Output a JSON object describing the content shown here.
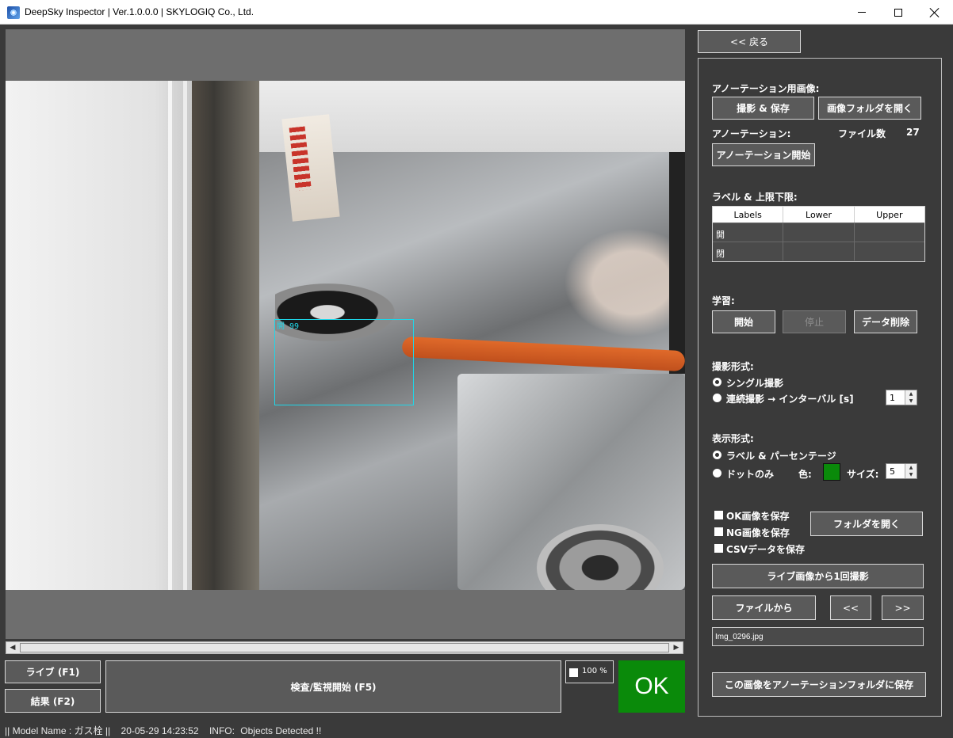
{
  "window": {
    "title": "DeepSky Inspector | Ver.1.0.0.0 | SKYLOGIQ Co., Ltd."
  },
  "viewer": {
    "detection_label": "開 99"
  },
  "bottom": {
    "live_button": "ライブ (F1)",
    "result_button": "結果 (F2)",
    "inspect_button": "検査/監視開始 (F5)",
    "percent_label": "100 %",
    "verdict": "OK",
    "verdict_color": "#0a8a0a"
  },
  "status": {
    "model": "|| Model Name : ガス栓 ||",
    "datetime": "20-05-29 14:23:52",
    "info_key": "INFO:",
    "info_value": "Objects Detected !!"
  },
  "panel": {
    "back_button": "<< 戻る",
    "annot_images_label": "アノーテーション用画像:",
    "capture_save_button": "撮影 & 保存",
    "open_image_folder_button": "画像フォルダを開く",
    "annotation_label": "アノーテーション:",
    "file_count_label": "ファイル数",
    "file_count": "27",
    "start_annotation_button": "アノーテーション開始",
    "labels_limits_label": "ラベル & 上限下限:",
    "table": {
      "headers": [
        "Labels",
        "Lower",
        "Upper"
      ],
      "rows": [
        [
          "開",
          "",
          ""
        ],
        [
          "閉",
          "",
          ""
        ]
      ]
    },
    "learning_label": "学習:",
    "start_button": "開始",
    "stop_button": "停止",
    "delete_data_button": "データ削除",
    "capture_mode_label": "撮影形式:",
    "single_capture": "シングル撮影",
    "continuous_capture": "連続撮影 → インターバル [s]",
    "interval_value": "1",
    "display_mode_label": "表示形式:",
    "label_percentage": "ラベル & パーセンテージ",
    "dot_only": "ドットのみ",
    "color_label": "色:",
    "size_label": "サイズ:",
    "size_value": "5",
    "save_ok": "OK画像を保存",
    "save_ng": "NG画像を保存",
    "save_csv": "CSVデータを保存",
    "open_folder_button": "フォルダを開く",
    "capture_once_button": "ライブ画像から1回撮影",
    "from_file_button": "ファイルから",
    "prev_button": "<<",
    "next_button": ">>",
    "filename": "Img_0296.jpg",
    "save_to_annotation_button": "この画像をアノーテーションフォルダに保存",
    "dot_color": "#0a8a0a"
  }
}
